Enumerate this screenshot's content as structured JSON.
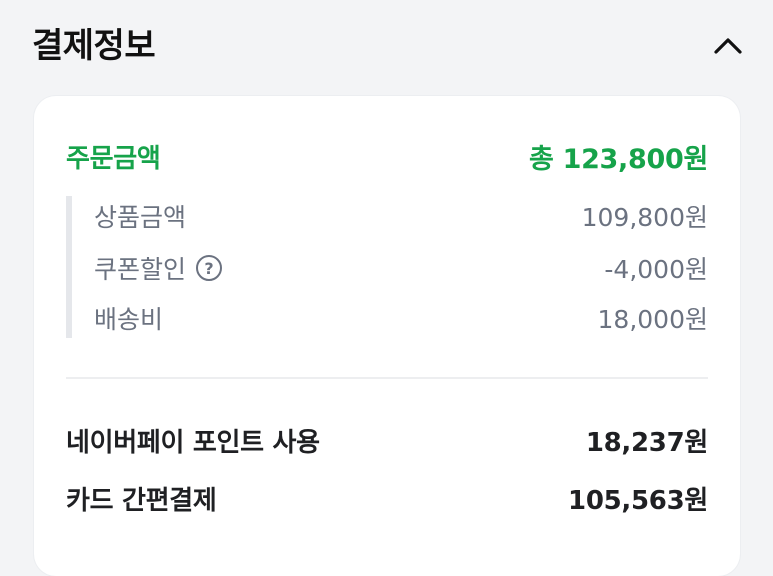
{
  "section": {
    "title": "결제정보",
    "collapse_icon": "chevron-up-icon"
  },
  "order": {
    "label": "주문금액",
    "total": "총 123,800원",
    "accent_color": "#16a34a"
  },
  "details": [
    {
      "label": "상품금액",
      "value": "109,800원"
    },
    {
      "label": "쿠폰할인",
      "value": "-4,000원",
      "help_icon": "question-circle-icon",
      "help_glyph": "?"
    },
    {
      "label": "배송비",
      "value": "18,000원"
    }
  ],
  "payments": [
    {
      "label": "네이버페이 포인트 사용",
      "value": "18,237원"
    },
    {
      "label": "카드 간편결제",
      "value": "105,563원"
    }
  ]
}
